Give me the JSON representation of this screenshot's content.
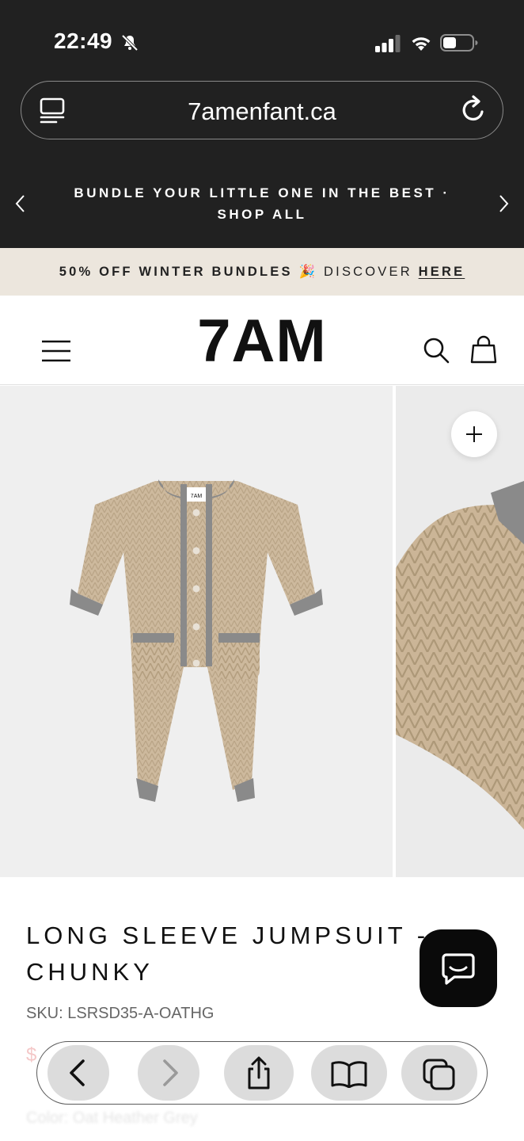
{
  "status_bar": {
    "time": "22:49"
  },
  "browser": {
    "url": "7amenfant.ca"
  },
  "announcement": {
    "text": "BUNDLE YOUR LITTLE ONE IN THE BEST · SHOP ALL"
  },
  "promo": {
    "text": "50% OFF WINTER BUNDLES",
    "emoji": "🎉",
    "discover": "DISCOVER",
    "link": "HERE"
  },
  "header": {
    "logo": "7AM",
    "label": "7AM"
  },
  "product": {
    "title": "LONG SLEEVE JUMPSUIT - CHUNKY",
    "sku": "SKU: LSRSD35-A-OATHG",
    "price": "$",
    "color": "Color: Oat Heather Grey",
    "tag_label": "7AM"
  },
  "icons": {
    "tabs": "tabs-icon",
    "reload": "reload-icon",
    "menu": "hamburger-menu-icon",
    "search": "search-icon",
    "bag": "shopping-bag-icon",
    "zoom": "plus-icon",
    "chat": "chat-icon",
    "back": "back-chevron-icon",
    "forward": "forward-chevron-icon",
    "share": "share-icon",
    "bookmarks": "book-icon",
    "tabs_overview": "tabs-overview-icon"
  },
  "colors": {
    "dark_bar": "#212121",
    "promo_bg": "#ece6dd",
    "knit": "#cdb99d",
    "trim": "#8a8a8a"
  }
}
